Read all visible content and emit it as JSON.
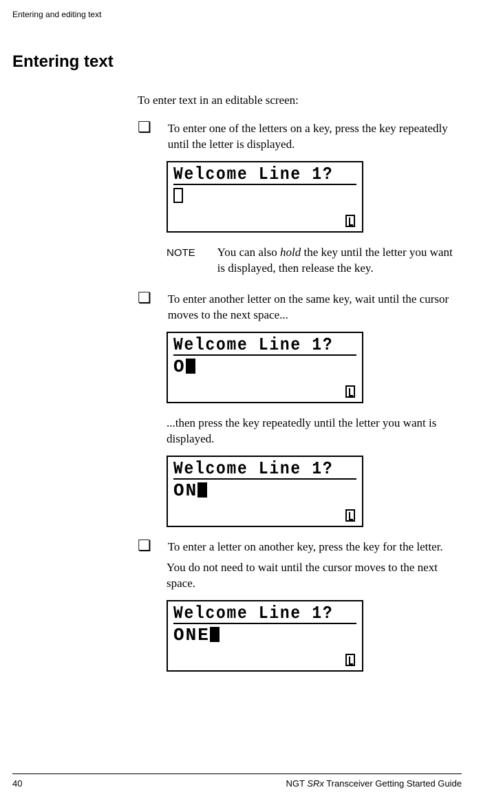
{
  "header": {
    "running_title": "Entering and editing text"
  },
  "section": {
    "title": "Entering text",
    "intro": "To enter text in an editable screen:"
  },
  "steps": {
    "step1": {
      "text": "To enter one of the letters on a key, press the key repeatedly until the letter is displayed."
    },
    "step2": {
      "text": "To enter another letter on the same key, wait until the cursor moves to the next space..."
    },
    "step2_cont": "...then press the key repeatedly until the letter you want is displayed.",
    "step3": {
      "text": "To enter a letter on another key, press the key for the letter.",
      "text2": "You do not need to wait until the cursor moves to the next space."
    }
  },
  "lcd": {
    "title": "Welcome Line 1?",
    "screen1_input": "",
    "screen2_input": "O",
    "screen3_input": "ON",
    "screen4_input": "ONE"
  },
  "note": {
    "label": "NOTE",
    "text_before": "You can also ",
    "text_italic": "hold",
    "text_after": " the key until the letter you want is displayed, then release the key."
  },
  "footer": {
    "page": "40",
    "prefix": "NGT ",
    "model": "SRx",
    "suffix": " Transceiver Getting Started Guide"
  }
}
